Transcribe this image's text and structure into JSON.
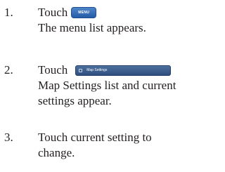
{
  "steps": [
    {
      "number": "1.",
      "touch_label": "Touch",
      "button_label": "MENU",
      "lines": [
        "The menu list appears."
      ]
    },
    {
      "number": "2.",
      "touch_label": "Touch",
      "button_label": "Map Settings",
      "lines": [
        "Map Settings list and current",
        "settings appear."
      ]
    },
    {
      "number": "3.",
      "lines": [
        "Touch current setting to",
        "change."
      ]
    }
  ],
  "colors": {
    "text": "#231f20",
    "menu_button": "#2f66b3",
    "map_settings_button": "#3a5b8c"
  }
}
